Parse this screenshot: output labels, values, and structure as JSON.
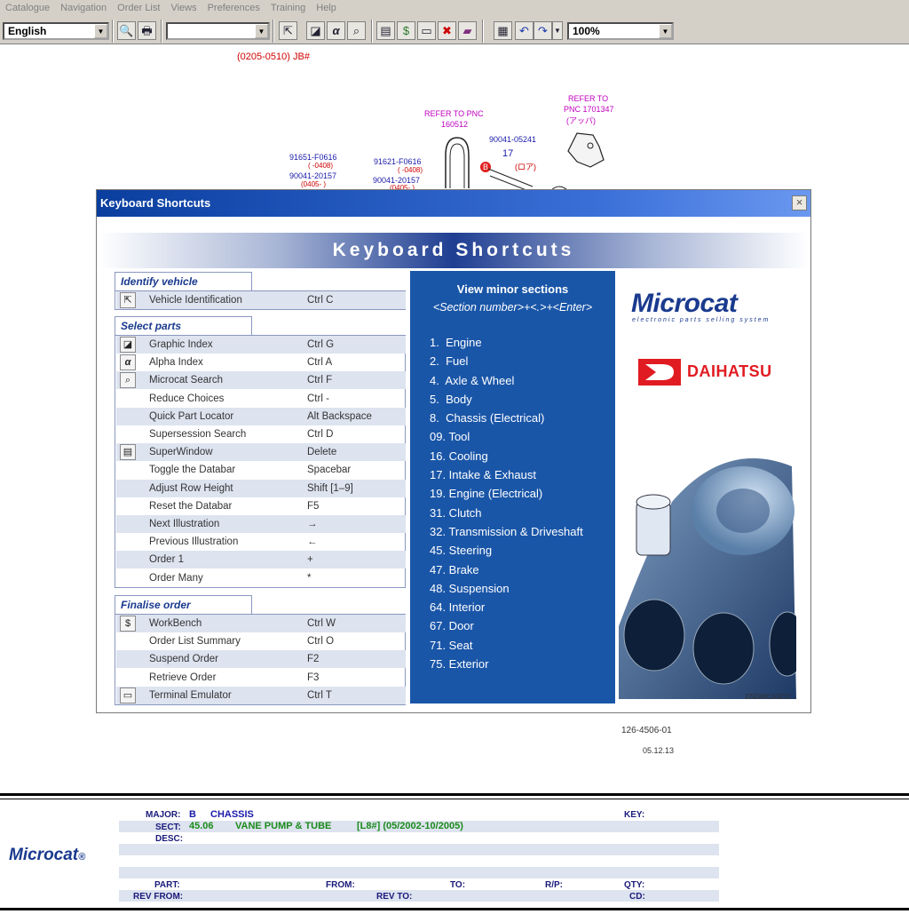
{
  "menu": [
    "Catalogue",
    "Navigation",
    "Order List",
    "Views",
    "Preferences",
    "Training",
    "Help"
  ],
  "toolbar": {
    "language": "English",
    "search_value": "",
    "zoom": "100%"
  },
  "diagram": {
    "header": "(0205-0510) JB#",
    "labels": {
      "refer_pnc_1": "REFER TO PNC",
      "refer_pnc_1_num": "160512",
      "refer_to_2": "REFER TO",
      "refer_pnc_2": "PNC 1701347",
      "refer_pnc_2_jp": "(アッパ)",
      "p1": "91651-F0616",
      "p1a": "( -0408)",
      "p2": "90041-20157",
      "p2a": "(0405- )",
      "p3": "91621-F0616",
      "p3a": "( -0408)",
      "p4": "90041-20157",
      "p4a": "(0405- )",
      "p5": "90041-05241",
      "p5a": "17",
      "p5b": "(ロア)",
      "b_marker": "B"
    },
    "drawing_no": "126-4506-01",
    "date": "05.12.13"
  },
  "dialog": {
    "title": "Keyboard Shortcuts",
    "banner": "Keyboard Shortcuts",
    "sections": [
      {
        "title": "Identify vehicle",
        "rows": [
          {
            "label": "Vehicle Identification",
            "key": "Ctrl C",
            "icon": "vehicle-id-icon"
          }
        ]
      },
      {
        "title": "Select parts",
        "rows": [
          {
            "label": "Graphic Index",
            "key": "Ctrl G",
            "icon": "graphic-index-icon"
          },
          {
            "label": "Alpha Index",
            "key": "Ctrl A",
            "icon": "alpha-icon"
          },
          {
            "label": "Microcat Search",
            "key": "Ctrl F",
            "icon": "search-icon"
          },
          {
            "label": "Reduce Choices",
            "key": "Ctrl -",
            "icon": ""
          },
          {
            "label": "Quick Part Locator",
            "key": "Alt Backspace",
            "icon": ""
          },
          {
            "label": "Supersession Search",
            "key": "Ctrl D",
            "icon": ""
          },
          {
            "label": "SuperWindow",
            "key": "Delete",
            "icon": "superwindow-icon"
          },
          {
            "label": "Toggle the Databar",
            "key": "Spacebar",
            "icon": ""
          },
          {
            "label": "Adjust Row Height",
            "key": "Shift [1–9]",
            "icon": ""
          },
          {
            "label": "Reset the Databar",
            "key": "F5",
            "icon": ""
          },
          {
            "label": "Next Illustration",
            "key": "→",
            "icon": ""
          },
          {
            "label": "Previous Illustration",
            "key": "←",
            "icon": ""
          },
          {
            "label": "Order 1",
            "key": "+",
            "icon": ""
          },
          {
            "label": "Order Many",
            "key": "*",
            "icon": ""
          }
        ]
      },
      {
        "title": "Finalise order",
        "rows": [
          {
            "label": "WorkBench",
            "key": "Ctrl W",
            "icon": "workbench-icon"
          },
          {
            "label": "Order List Summary",
            "key": "Ctrl O",
            "icon": ""
          },
          {
            "label": "Suspend Order",
            "key": "F2",
            "icon": ""
          },
          {
            "label": "Retrieve Order",
            "key": "F3",
            "icon": ""
          },
          {
            "label": "Terminal Emulator",
            "key": "Ctrl T",
            "icon": "terminal-icon"
          }
        ]
      }
    ],
    "minor": {
      "heading": "View minor sections",
      "subheading": "<Section number>+<.>+<Enter>",
      "items": [
        "1.  Engine",
        "2.  Fuel",
        "4.  Axle & Wheel",
        "5.  Body",
        "8.  Chassis (Electrical)",
        "09. Tool",
        "16. Cooling",
        "17. Intake & Exhaust",
        "19. Engine (Electrical)",
        "31. Clutch",
        "32. Transmission & Driveshaft",
        "45. Steering",
        "47. Brake",
        "48. Suspension",
        "64. Interior",
        "67. Door",
        "71. Seat",
        "75. Exterior"
      ]
    },
    "brand": {
      "microcat": "Microcat",
      "microcat_tag": "electronic parts selling system",
      "daihatsu": "DAIHATSU",
      "code": "ENDMCASCC"
    }
  },
  "footer": {
    "logo": "Microcat",
    "major_label": "MAJOR:",
    "major_code": "B",
    "major_name": "CHASSIS",
    "sect_label": "SECT:",
    "sect_code": "45.06",
    "sect_name": "VANE PUMP & TUBE",
    "sect_extra": "[L8#] (05/2002-10/2005)",
    "desc_label": "DESC:",
    "key_label": "KEY:",
    "part_label": "PART:",
    "from_label": "FROM:",
    "to_label": "TO:",
    "rp_label": "R/P:",
    "qty_label": "QTY:",
    "revfrom_label": "REV FROM:",
    "revto_label": "REV TO:",
    "cd_label": "CD:"
  },
  "colors": {
    "accent": "#1a56a8",
    "title_bar": "#0a3e9e",
    "daihatsu_red": "#e11b22"
  }
}
